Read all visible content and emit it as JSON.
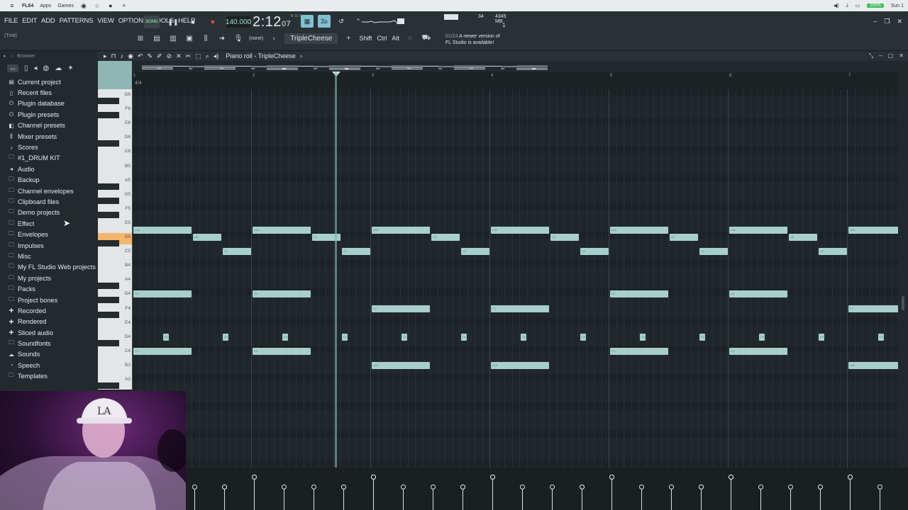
{
  "os_tabs": [
    "FL64",
    "Apps",
    "Games"
  ],
  "os_status": {
    "battery": "100%",
    "time": "Sun 1"
  },
  "menu": [
    "FILE",
    "EDIT",
    "ADD",
    "PATTERNS",
    "VIEW",
    "OPTIONS",
    "TOOLS",
    "HELP"
  ],
  "trial": "(Trial)",
  "transport": {
    "song_label": "SONG",
    "tempo": "140.000",
    "time_main": "2:12",
    "time_sub": "07",
    "bst": "B:S:T"
  },
  "monitor": {
    "cpu_val": "34",
    "memory": "4345 MB",
    "poly": "1"
  },
  "toolbar2": {
    "snap": "(none)",
    "pattern": "TripleCheese",
    "shift": "Shift",
    "ctrl": "Ctrl",
    "alt": "Alt"
  },
  "notice": {
    "count": "01/24",
    "line1": "A newer version of",
    "line2": "FL Studio is available!"
  },
  "browser": {
    "title": "Browser",
    "items": [
      {
        "label": "Current project",
        "icon": "project-icon"
      },
      {
        "label": "Recent files",
        "icon": "file-icon"
      },
      {
        "label": "Plugin database",
        "icon": "plug-icon"
      },
      {
        "label": "Plugin presets",
        "icon": "plug-icon"
      },
      {
        "label": "Channel presets",
        "icon": "channel-icon"
      },
      {
        "label": "Mixer presets",
        "icon": "mixer-icon"
      },
      {
        "label": "Scores",
        "icon": "note-icon"
      },
      {
        "label": "#1_DRUM KIT",
        "icon": "folder-icon"
      },
      {
        "label": "Audio",
        "icon": "speaker-icon"
      },
      {
        "label": "Backup",
        "icon": "folder-icon"
      },
      {
        "label": "Channel envelopes",
        "icon": "folder-icon"
      },
      {
        "label": "Clipboard files",
        "icon": "folder-icon"
      },
      {
        "label": "Demo projects",
        "icon": "folder-icon"
      },
      {
        "label": "Effect",
        "icon": "folder-icon"
      },
      {
        "label": "Envelopes",
        "icon": "folder-icon"
      },
      {
        "label": "Impulses",
        "icon": "folder-icon"
      },
      {
        "label": "Misc",
        "icon": "folder-icon"
      },
      {
        "label": "My FL Studio Web projects",
        "icon": "folder-icon"
      },
      {
        "label": "My projects",
        "icon": "folder-icon"
      },
      {
        "label": "Packs",
        "icon": "folder-icon"
      },
      {
        "label": "Project bones",
        "icon": "folder-icon"
      },
      {
        "label": "Recorded",
        "icon": "plus-icon"
      },
      {
        "label": "Rendered",
        "icon": "plus-icon"
      },
      {
        "label": "Sliced audio",
        "icon": "plus-icon"
      },
      {
        "label": "Soundfonts",
        "icon": "folder-icon"
      },
      {
        "label": "Sounds",
        "icon": "cloud-icon"
      },
      {
        "label": "Speech",
        "icon": "speech-icon"
      },
      {
        "label": "Templates",
        "icon": "folder-icon"
      }
    ]
  },
  "piano_roll": {
    "title": "Piano roll - TripleCheese",
    "time_sig": "4/4",
    "bars": [
      "1",
      "2",
      "3",
      "4",
      "5",
      "6",
      "7"
    ],
    "key_labels": [
      "G6",
      "F6",
      "E6",
      "D6",
      "C6",
      "B5",
      "A5",
      "G5",
      "F5",
      "E5",
      "D5",
      "C5",
      "B4",
      "A4",
      "G4",
      "F4",
      "E4",
      "D4",
      "C4",
      "B3",
      "A3"
    ],
    "highlight_key": "D5",
    "notes": [
      {
        "pitch": "D#5",
        "row": 9.5,
        "start": 0,
        "len": 0.5
      },
      {
        "pitch": "D#5",
        "row": 9.5,
        "start": 1,
        "len": 0.5
      },
      {
        "pitch": "D#5",
        "row": 9.5,
        "start": 2,
        "len": 0.5
      },
      {
        "pitch": "D#5",
        "row": 9.5,
        "start": 3,
        "len": 0.5
      },
      {
        "pitch": "D#5",
        "row": 9.5,
        "start": 4,
        "len": 0.5
      },
      {
        "pitch": "D#5",
        "row": 9.5,
        "start": 5,
        "len": 0.5
      },
      {
        "pitch": "D#5",
        "row": 9.5,
        "start": 6,
        "len": 0.5
      },
      {
        "pitch": "D5",
        "row": 10,
        "start": 0.5,
        "len": 0.25
      },
      {
        "pitch": "D5",
        "row": 10,
        "start": 1.5,
        "len": 0.25
      },
      {
        "pitch": "D5",
        "row": 10,
        "start": 2.5,
        "len": 0.25
      },
      {
        "pitch": "D5",
        "row": 10,
        "start": 3.5,
        "len": 0.25
      },
      {
        "pitch": "D5",
        "row": 10,
        "start": 4.5,
        "len": 0.25
      },
      {
        "pitch": "D5",
        "row": 10,
        "start": 5.5,
        "len": 0.25
      },
      {
        "pitch": "C5",
        "row": 11,
        "start": 0.75,
        "len": 0.25
      },
      {
        "pitch": "C5",
        "row": 11,
        "start": 1.75,
        "len": 0.25
      },
      {
        "pitch": "C5",
        "row": 11,
        "start": 2.75,
        "len": 0.25
      },
      {
        "pitch": "C5",
        "row": 11,
        "start": 3.75,
        "len": 0.25
      },
      {
        "pitch": "C5",
        "row": 11,
        "start": 4.75,
        "len": 0.25
      },
      {
        "pitch": "C5",
        "row": 11,
        "start": 5.75,
        "len": 0.25
      },
      {
        "pitch": "G4",
        "row": 14,
        "start": 0,
        "len": 0.5
      },
      {
        "pitch": "G4",
        "row": 14,
        "start": 1,
        "len": 0.5
      },
      {
        "pitch": "G4",
        "row": 14,
        "start": 4,
        "len": 0.5
      },
      {
        "pitch": "G4",
        "row": 14,
        "start": 5,
        "len": 0.5
      },
      {
        "pitch": "F4",
        "row": 15,
        "start": 2,
        "len": 0.5
      },
      {
        "pitch": "F4",
        "row": 15,
        "start": 3,
        "len": 0.5
      },
      {
        "pitch": "F4",
        "row": 15,
        "start": 6,
        "len": 0.5
      },
      {
        "pitch": "D4",
        "row": 17,
        "start": 0.25,
        "len": 0.06
      },
      {
        "pitch": "D4",
        "row": 17,
        "start": 0.75,
        "len": 0.06
      },
      {
        "pitch": "D4",
        "row": 17,
        "start": 1.25,
        "len": 0.06
      },
      {
        "pitch": "D4",
        "row": 17,
        "start": 1.75,
        "len": 0.06
      },
      {
        "pitch": "D4",
        "row": 17,
        "start": 2.25,
        "len": 0.06
      },
      {
        "pitch": "D4",
        "row": 17,
        "start": 2.75,
        "len": 0.06
      },
      {
        "pitch": "D4",
        "row": 17,
        "start": 3.25,
        "len": 0.06
      },
      {
        "pitch": "D4",
        "row": 17,
        "start": 3.75,
        "len": 0.06
      },
      {
        "pitch": "D4",
        "row": 17,
        "start": 4.25,
        "len": 0.06
      },
      {
        "pitch": "D4",
        "row": 17,
        "start": 4.75,
        "len": 0.06
      },
      {
        "pitch": "D4",
        "row": 17,
        "start": 5.25,
        "len": 0.06
      },
      {
        "pitch": "D4",
        "row": 17,
        "start": 5.75,
        "len": 0.06
      },
      {
        "pitch": "D4",
        "row": 17,
        "start": 6.25,
        "len": 0.06
      },
      {
        "pitch": "C4",
        "row": 18,
        "start": 0,
        "len": 0.5
      },
      {
        "pitch": "C4",
        "row": 18,
        "start": 1,
        "len": 0.5
      },
      {
        "pitch": "C4",
        "row": 18,
        "start": 4,
        "len": 0.5
      },
      {
        "pitch": "C4",
        "row": 18,
        "start": 5,
        "len": 0.5
      },
      {
        "pitch": "A#3",
        "row": 19,
        "start": 2,
        "len": 0.5
      },
      {
        "pitch": "A#3",
        "row": 19,
        "start": 3,
        "len": 0.5
      },
      {
        "pitch": "A#3",
        "row": 19,
        "start": 6,
        "len": 0.5
      }
    ]
  }
}
